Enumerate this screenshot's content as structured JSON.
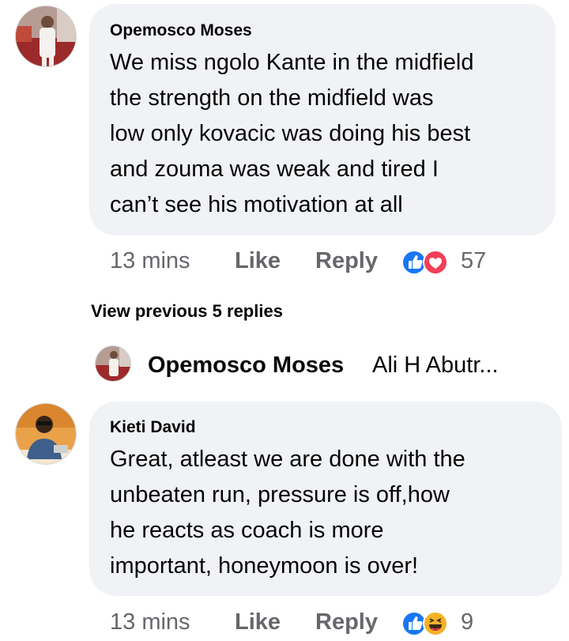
{
  "comments": [
    {
      "author": "Opemosco Moses",
      "lines": [
        "We miss ngolo Kante in the midfield",
        "the strength on the midfield was",
        "low only kovacic was doing his best",
        "and zouma was weak and tired I",
        "can’t see his motivation at all"
      ],
      "time": "13 mins",
      "like_label": "Like",
      "reply_label": "Reply",
      "reactions": [
        "like-icon",
        "love-icon"
      ],
      "reaction_count": "57"
    },
    {
      "author": "Kieti David",
      "lines": [
        "Great, atleast we are done with the",
        "unbeaten run, pressure is off,how",
        "he reacts as coach is more",
        "important, honeymoon is over!"
      ],
      "time": "13 mins",
      "like_label": "Like",
      "reply_label": "Reply",
      "reactions": [
        "like-icon",
        "haha-icon"
      ],
      "reaction_count": "9"
    }
  ],
  "view_previous": "View previous 5 replies",
  "reply_preview": {
    "author": "Opemosco Moses",
    "text": "Ali H Abutr..."
  },
  "colors": {
    "bubble": "#f0f2f5",
    "meta": "#65676b",
    "like_blue": "#1877f2",
    "love_red": "#f33e58",
    "haha_yellow": "#f7b125"
  }
}
